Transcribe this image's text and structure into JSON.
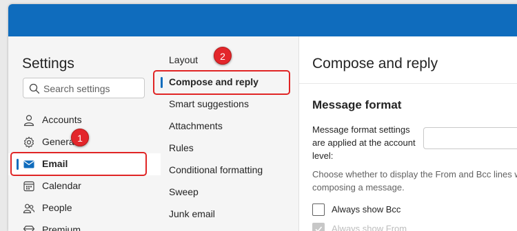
{
  "settings": {
    "title": "Settings",
    "search_placeholder": "Search settings"
  },
  "nav": {
    "items": [
      {
        "label": "Accounts",
        "icon": "person-icon"
      },
      {
        "label": "General",
        "icon": "gear-icon"
      },
      {
        "label": "Email",
        "icon": "mail-icon",
        "selected": true
      },
      {
        "label": "Calendar",
        "icon": "calendar-icon"
      },
      {
        "label": "People",
        "icon": "people-icon"
      },
      {
        "label": "Premium",
        "icon": "diamond-icon"
      }
    ]
  },
  "subnav": {
    "items": [
      {
        "label": "Layout"
      },
      {
        "label": "Compose and reply",
        "selected": true
      },
      {
        "label": "Smart suggestions"
      },
      {
        "label": "Attachments"
      },
      {
        "label": "Rules"
      },
      {
        "label": "Conditional formatting"
      },
      {
        "label": "Sweep"
      },
      {
        "label": "Junk email"
      }
    ]
  },
  "content": {
    "title": "Compose and reply",
    "section_title": "Message format",
    "format_label": "Message format settings are applied at the account level:",
    "description_line1": "Choose whether to display the From and Bcc lines when",
    "description_line2": "composing a message.",
    "checkboxes": [
      {
        "label": "Always show Bcc",
        "checked": false
      },
      {
        "label": "Always show From",
        "checked": true
      }
    ]
  },
  "annotations": {
    "badge_1": "1",
    "badge_2": "2",
    "highlight_color": "#e02424"
  },
  "colors": {
    "accent": "#0f6cbd",
    "pane_bg": "#f5f5f5"
  }
}
